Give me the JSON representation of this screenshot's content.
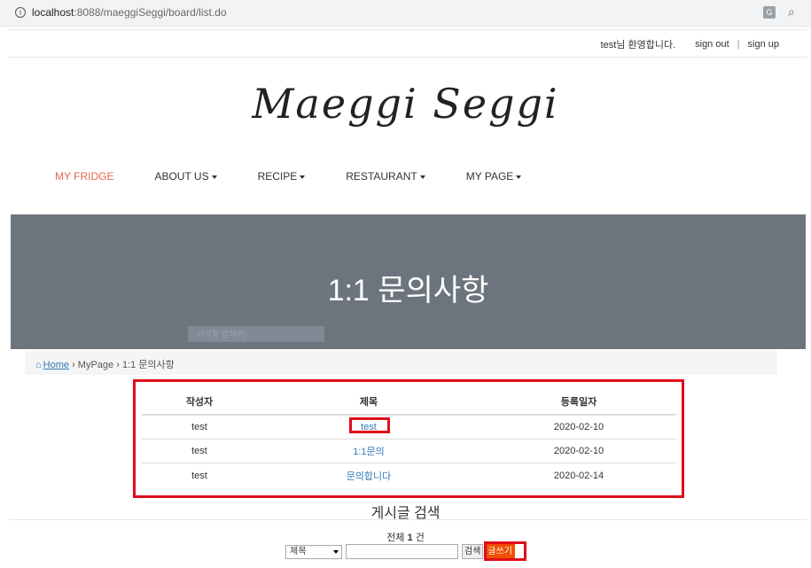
{
  "browser": {
    "info_glyph": "i",
    "url_host": "localhost",
    "url_rest": ":8088/maeggiSeggi/board/list.do",
    "translate_glyph": "G"
  },
  "userbar": {
    "welcome": "test님 환영합니다.",
    "sign_out": "sign out",
    "separator": "|",
    "sign_up": "sign up"
  },
  "logo": "Maeggi Seggi",
  "nav": {
    "items": [
      {
        "label": "MY FRIDGE",
        "dropdown": false,
        "active": true
      },
      {
        "label": "ABOUT US",
        "dropdown": true
      },
      {
        "label": "RECIPE",
        "dropdown": true
      },
      {
        "label": "RESTAURANT",
        "dropdown": true
      },
      {
        "label": "MY PAGE",
        "dropdown": true
      }
    ],
    "active_color": "#e8674a"
  },
  "banner": {
    "title": "1:1 문의사항",
    "ghost_text": "사각형 캡처(R)",
    "background": "#6c757d"
  },
  "breadcrumb": {
    "home": "Home",
    "sep1": "›",
    "mypage": "MyPage",
    "sep2": "›",
    "current": "1:1 문의사항"
  },
  "table": {
    "headers": {
      "writer": "작성자",
      "title": "제목",
      "date": "등록일자"
    },
    "rows": [
      {
        "writer": "test",
        "title": "test",
        "date": "2020-02-10"
      },
      {
        "writer": "test",
        "title": "1:1문의",
        "date": "2020-02-10"
      },
      {
        "writer": "test",
        "title": "문의합니다",
        "date": "2020-02-14"
      }
    ]
  },
  "search": {
    "title": "게시글 검색",
    "total_prefix": "전체",
    "total_count": "1",
    "total_suffix": "건",
    "select_value": "제목",
    "button_search": "검색",
    "button_write": "글쓰기"
  },
  "colors": {
    "highlight_border": "#e00d1a",
    "write_button": "#f04e00",
    "link": "#337ab7"
  }
}
